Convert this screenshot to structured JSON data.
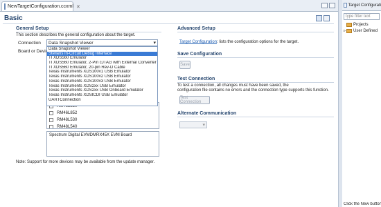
{
  "editor": {
    "tab_title": "NewTargetConfiguration.ccxml",
    "tab_close": "✕",
    "page_title": "Basic"
  },
  "general_setup": {
    "title": "General Setup",
    "description": "This section describes the general configuration about the target.",
    "connection_label": "Connection",
    "connection_value": "Data Snapshot Viewer",
    "board_label": "Board or Device",
    "dropdown_options": [
      "Data Snapshot Viewer",
      "Stellaris In-Circuit Debug Interface",
      "TI XDS560 Emulator",
      "TI XDS560 Emulator, 2-Pin cJTAG with External Converter",
      "TI XDS560 Emulator, 20-pin Rev-D Cable",
      "Texas Instruments XDS100v1 USB Emulator",
      "Texas Instruments XDS100v2 USB Emulator",
      "Texas Instruments XDS100v3 USB Emulator",
      "Texas Instruments XDS2xx USB Emulator",
      "Texas Instruments XDS2xx USB Onboard Emulator",
      "Texas Instruments XDSICDI USB Emulator",
      "UARTConnection"
    ],
    "selected_option_index": 1,
    "devices": [
      "RM46L830",
      "RM46L852",
      "RM48L530",
      "RM48L540"
    ],
    "board_description": "Spectrum Digital EVMDMRX45X EVM Board",
    "note": "Note: Support for more devices may be available from the update manager."
  },
  "advanced_setup": {
    "title": "Advanced Setup",
    "link_text": "Target Configuration",
    "link_suffix": ": lists the configuration options for the target."
  },
  "save_configuration": {
    "title": "Save Configuration",
    "button": "Save"
  },
  "test_connection": {
    "title": "Test Connection",
    "text_line1": "To test a connection, all changes must have been saved, the",
    "text_line2": "configuration file contains no errors and the connection type supports this function.",
    "button": "Test Connection"
  },
  "alternate_communication": {
    "title": "Alternate Communication"
  },
  "right_panel": {
    "tab_title": "Target Configurati",
    "filter_placeholder": "type filter text",
    "tree": [
      "Projects",
      "User Defined"
    ],
    "bottom_text": "Click the New button"
  },
  "colors": {
    "accent": "#25456e",
    "selection": "#3a7bd5",
    "link": "#1f5fb4"
  }
}
